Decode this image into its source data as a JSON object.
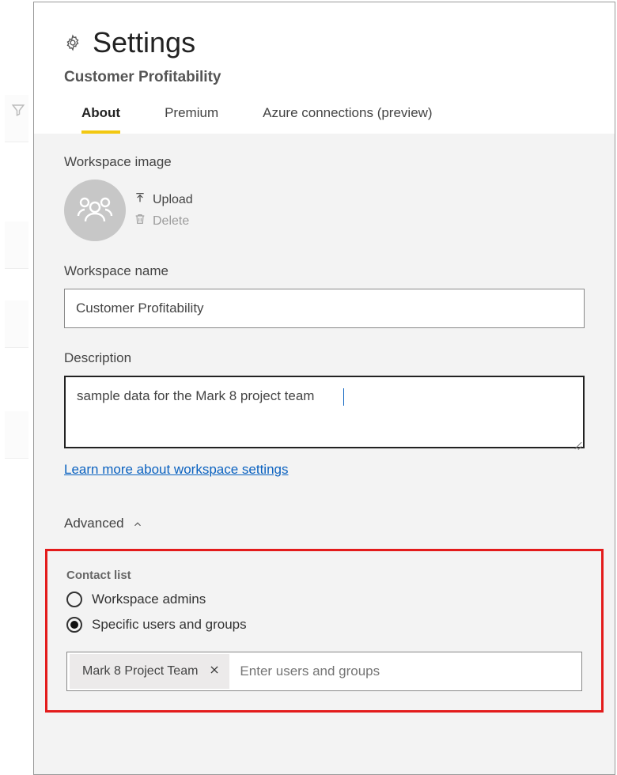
{
  "title": "Settings",
  "subtitle": "Customer Profitability",
  "tabs": {
    "about": "About",
    "premium": "Premium",
    "azure": "Azure connections (preview)"
  },
  "workspace_image": {
    "label": "Workspace image",
    "upload_label": "Upload",
    "delete_label": "Delete"
  },
  "workspace_name": {
    "label": "Workspace name",
    "value": "Customer Profitability"
  },
  "description": {
    "label": "Description",
    "value": "sample data for the Mark 8 project team"
  },
  "learn_more": "Learn more about workspace settings",
  "advanced_label": "Advanced",
  "contact_list": {
    "label": "Contact list",
    "option_admins": "Workspace admins",
    "option_specific": "Specific users and groups",
    "selected": "specific",
    "chips": [
      {
        "label": "Mark 8 Project Team"
      }
    ],
    "placeholder": "Enter users and groups"
  },
  "icons": {
    "gear": "gear-icon",
    "upload": "upload-icon",
    "trash": "trash-icon",
    "chevron_up": "chevron-up-icon",
    "close": "close-icon",
    "people": "people-icon",
    "funnel": "funnel-icon"
  }
}
